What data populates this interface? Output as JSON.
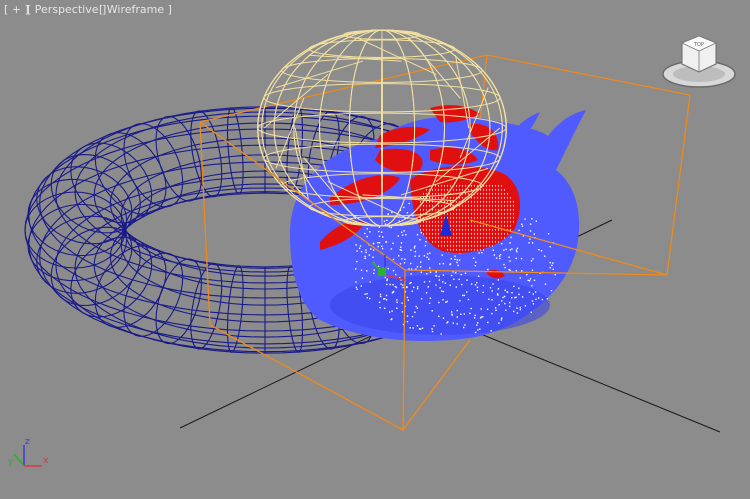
{
  "viewport": {
    "labels": {
      "plus": "[ + ]",
      "view": "[ Perspective ]",
      "shading": "[ Wireframe ]"
    },
    "background": "#8c8c8c"
  },
  "viewcube": {
    "face_label": "TOP"
  },
  "axis_tripod": {
    "x_label": "x",
    "y_label": "y",
    "z_label": "z"
  },
  "objects": {
    "torus": {
      "name": "torus-wireframe",
      "color": "#1a1a8a"
    },
    "sphere": {
      "name": "geosphere-wireframe",
      "color": "#f2e0a0"
    },
    "teapot": {
      "name": "teapot",
      "color": "#4f5aff"
    },
    "particles": {
      "name": "particle-cloud",
      "color": "#ff1a1a"
    },
    "box": {
      "name": "bounding-box",
      "color": "#ff9a1a"
    }
  },
  "colors": {
    "grid_line": "#1a1a1a",
    "torus_wire": "#1a1a8a",
    "sphere_wire": "#f2e0a0",
    "teapot_fill": "#4f5aff",
    "red_fill": "#e01010",
    "box_edge": "#f08a1a",
    "axis_x": "#d83a3a",
    "axis_y": "#2bb12b",
    "axis_z": "#3a3ad8"
  }
}
